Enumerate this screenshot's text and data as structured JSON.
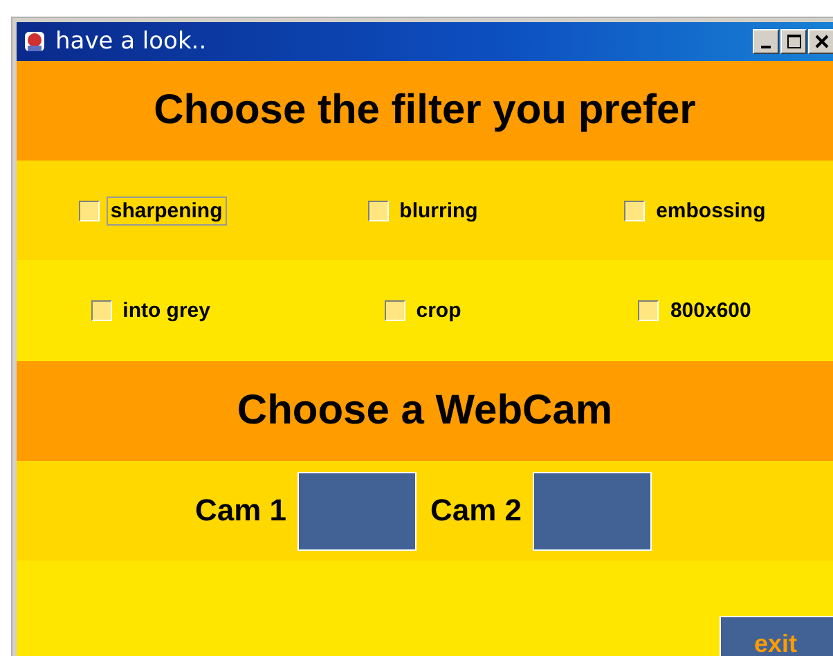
{
  "window": {
    "title": "have a look.."
  },
  "filter_heading": "Choose the filter you prefer",
  "filters": [
    [
      {
        "label": "sharpening",
        "checked": false,
        "focused": true
      },
      {
        "label": "blurring",
        "checked": false,
        "focused": false
      },
      {
        "label": "embossing",
        "checked": false,
        "focused": false
      }
    ],
    [
      {
        "label": "into grey",
        "checked": false,
        "focused": false
      },
      {
        "label": "crop",
        "checked": false,
        "focused": false
      },
      {
        "label": "800x600",
        "checked": false,
        "focused": false
      }
    ]
  ],
  "webcam_heading": "Choose a WebCam",
  "cams": [
    {
      "label": "Cam 1"
    },
    {
      "label": "Cam 2"
    }
  ],
  "exit_button": "exit"
}
